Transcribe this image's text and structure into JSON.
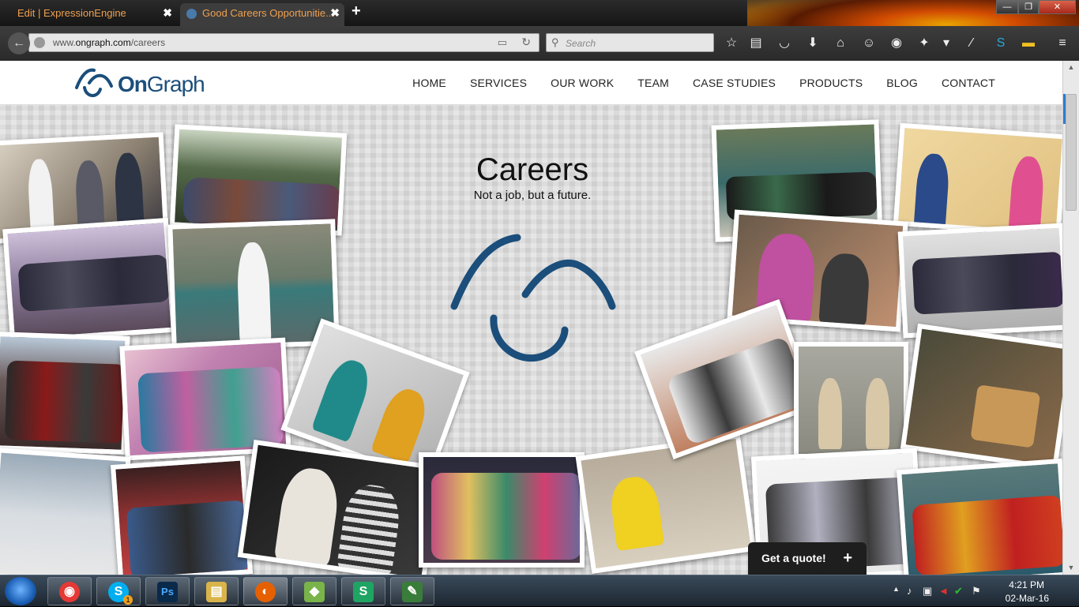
{
  "browser": {
    "tabs": [
      {
        "title": "Edit | ExpressionEngine",
        "close": "✖"
      },
      {
        "title": "Good Careers Opportunitie...",
        "close": "✖"
      }
    ],
    "new_tab": "+",
    "window_controls": {
      "minimize": "—",
      "maximize": "❐",
      "close": "✕"
    },
    "url": {
      "prefix": "www.",
      "domain": "ongraph.com",
      "path": "/careers"
    },
    "search_placeholder": "Search"
  },
  "site": {
    "logo_text_bold": "On",
    "logo_text": "Graph",
    "nav": [
      "HOME",
      "SERVICES",
      "OUR WORK",
      "TEAM",
      "CASE STUDIES",
      "PRODUCTS",
      "BLOG",
      "CONTACT"
    ],
    "hero": {
      "title": "Careers",
      "subtitle": "Not a job, but a future."
    },
    "quote_button": "Get a quote!",
    "quote_plus": "+",
    "brand_color": "#1b4e7b"
  },
  "taskbar": {
    "apps": [
      {
        "name": "chrome",
        "color": "#e53935",
        "glyph": "◉"
      },
      {
        "name": "skype",
        "color": "#00aff0",
        "glyph": "S",
        "badge": "1"
      },
      {
        "name": "photoshop",
        "color": "#0a2a4a",
        "glyph": "Ps"
      },
      {
        "name": "explorer",
        "color": "#d9b44a",
        "glyph": "▤"
      },
      {
        "name": "firefox",
        "color": "#e66000",
        "glyph": "◐"
      },
      {
        "name": "notes",
        "color": "#7ab34a",
        "glyph": "◆"
      },
      {
        "name": "sheets",
        "color": "#1fa463",
        "glyph": "S"
      },
      {
        "name": "editor",
        "color": "#3a7d3a",
        "glyph": "✎"
      }
    ],
    "clock_time": "4:21 PM",
    "clock_date": "02-Mar-16"
  }
}
